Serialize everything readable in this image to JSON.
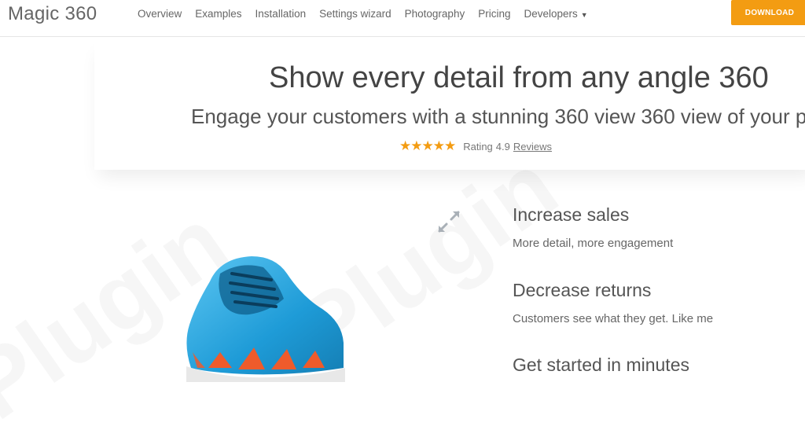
{
  "brand": {
    "name": "Magic 360"
  },
  "nav": {
    "items": [
      {
        "label": "Overview"
      },
      {
        "label": "Examples"
      },
      {
        "label": "Installation"
      },
      {
        "label": "Settings wizard"
      },
      {
        "label": "Photography"
      },
      {
        "label": "Pricing"
      },
      {
        "label": "Developers"
      }
    ],
    "cta_label": "DOWNLOAD"
  },
  "hero": {
    "title": "Show every detail from any angle 360",
    "subtitle": "Engage your customers with a stunning 360 view 360 view of your p",
    "stars": "★★★★★",
    "rating_label": "Rating",
    "rating_value": "4.9",
    "rating_link": "Reviews"
  },
  "features": [
    {
      "title": "Increase sales",
      "desc": "More detail, more engagement"
    },
    {
      "title": "Decrease returns",
      "desc": "Customers see what they get. Like me"
    },
    {
      "title": "Get started in minutes",
      "desc": ""
    }
  ],
  "watermark": {
    "text": "Plugin"
  },
  "colors": {
    "accent": "#f39c12",
    "shoe_blue": "#1e9bd7",
    "sole_orange": "#ef5b2b"
  },
  "icons": {
    "expand": "expand-arrows-icon"
  }
}
